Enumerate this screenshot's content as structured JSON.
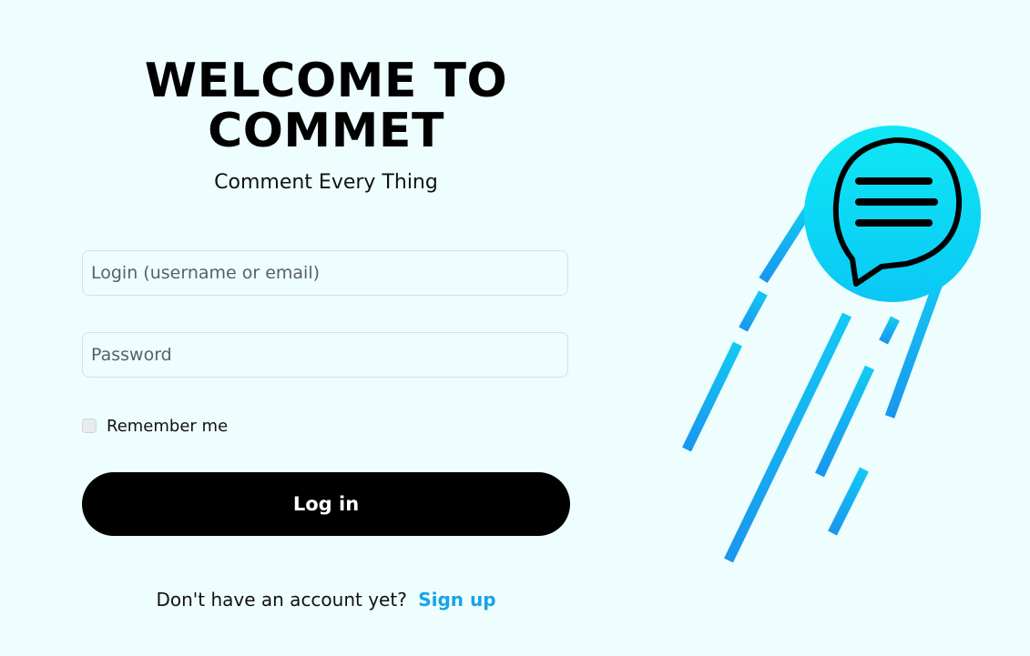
{
  "header": {
    "title_line1": "WELCOME TO",
    "title_line2": "COMMET",
    "subtitle": "Comment Every Thing"
  },
  "form": {
    "login_placeholder": "Login (username or email)",
    "login_value": "",
    "password_placeholder": "Password",
    "password_value": "",
    "remember_label": "Remember me",
    "remember_checked": false,
    "login_button_label": "Log in"
  },
  "footer": {
    "signup_prompt": "Don't have an account yet?",
    "signup_link_label": "Sign up"
  },
  "illustration": {
    "icon": "speech-bubble-comet-icon",
    "colors": {
      "circle_top": "#0fe8f5",
      "circle_bottom": "#0ac8f5",
      "trail": "#19a2ef",
      "bubble_outline": "#000000"
    }
  },
  "colors": {
    "background": "#eefefe",
    "button": "#000000",
    "link": "#17a3e8"
  }
}
